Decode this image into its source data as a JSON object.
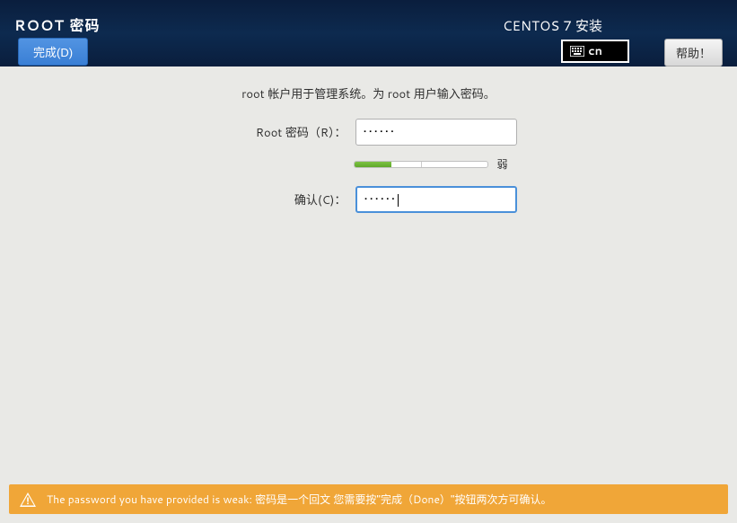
{
  "header": {
    "title": "ROOT 密码",
    "done_label": "完成(D)",
    "installer_name": "CENTOS 7 安装",
    "lang_code": "cn",
    "help_label": "帮助！"
  },
  "form": {
    "description": "root 帐户用于管理系统。为 root 用户输入密码。",
    "password_label": "Root 密码（R）：",
    "password_value": "••••••",
    "confirm_label": "确认(C)：",
    "confirm_value": "••••••",
    "strength_text": "弱",
    "strength_percent": 28
  },
  "warning": {
    "text": "The password you have provided is weak: 密码是一个回文 您需要按\"完成（Done）\"按钮两次方可确认。"
  }
}
